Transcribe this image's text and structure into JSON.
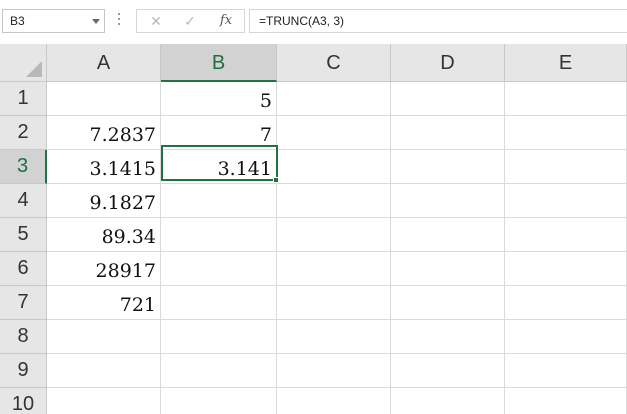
{
  "formula_bar": {
    "name_box": "B3",
    "cancel_glyph": "✕",
    "enter_glyph": "✓",
    "fx_label": "fx",
    "formula": "=TRUNC(A3, 3)"
  },
  "columns": [
    "A",
    "B",
    "C",
    "D",
    "E"
  ],
  "selected_column": "B",
  "rows": [
    "1",
    "2",
    "3",
    "4",
    "5",
    "6",
    "7",
    "8",
    "9",
    "10"
  ],
  "selected_row": "3",
  "cells": {
    "A": [
      "",
      "7.2837",
      "3.1415",
      "9.1827",
      "89.34",
      "28917",
      "721",
      "",
      "",
      ""
    ],
    "B": [
      "5",
      "7",
      "3.141",
      "",
      "",
      "",
      "",
      "",
      "",
      ""
    ]
  },
  "colors": {
    "accent": "#217346",
    "header_bg": "#e6e6e6",
    "selected_header_bg": "#d2d2d2"
  }
}
